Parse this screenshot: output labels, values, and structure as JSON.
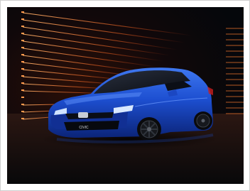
{
  "photo": {
    "subject": "blue-hatchback-car",
    "badge_text": "CIVIC",
    "colors": {
      "background": "#07090d",
      "car_body": "#1d4fd1",
      "light_trails": "#ff7a2e",
      "frame_border": "#cfcfcf"
    }
  }
}
